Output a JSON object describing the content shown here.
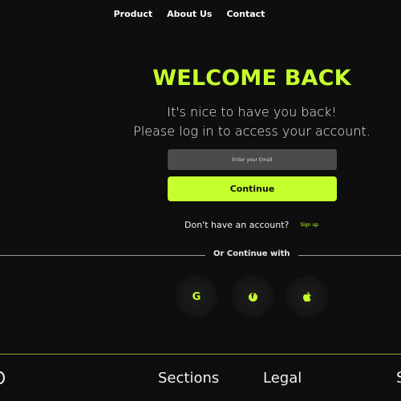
{
  "nav": {
    "items": [
      "Product",
      "About Us",
      "Contact"
    ]
  },
  "hero": {
    "title": "WELCOME BACK",
    "subtitle_line1": "It's nice to have you back!",
    "subtitle_line2": "Please log in to access your account."
  },
  "form": {
    "email_placeholder": "Enter your Email",
    "continue_label": "Continue"
  },
  "signup": {
    "prompt": "Don't have an account?",
    "link": "Sign up"
  },
  "divider": {
    "label": "Or Continue with"
  },
  "social": {
    "google_glyph": "G",
    "google_icon": "google-icon",
    "facebook_glyph": "f",
    "facebook_icon": "facebook-icon",
    "apple_icon": "apple-icon"
  },
  "footer": {
    "sections_heading": "Sections",
    "legal_heading": "Legal",
    "right_edge_glyph": "S"
  },
  "colors": {
    "background": "#0e0e0e",
    "accent": "#c6ff2e",
    "input_bg": "#4b4b4b"
  }
}
